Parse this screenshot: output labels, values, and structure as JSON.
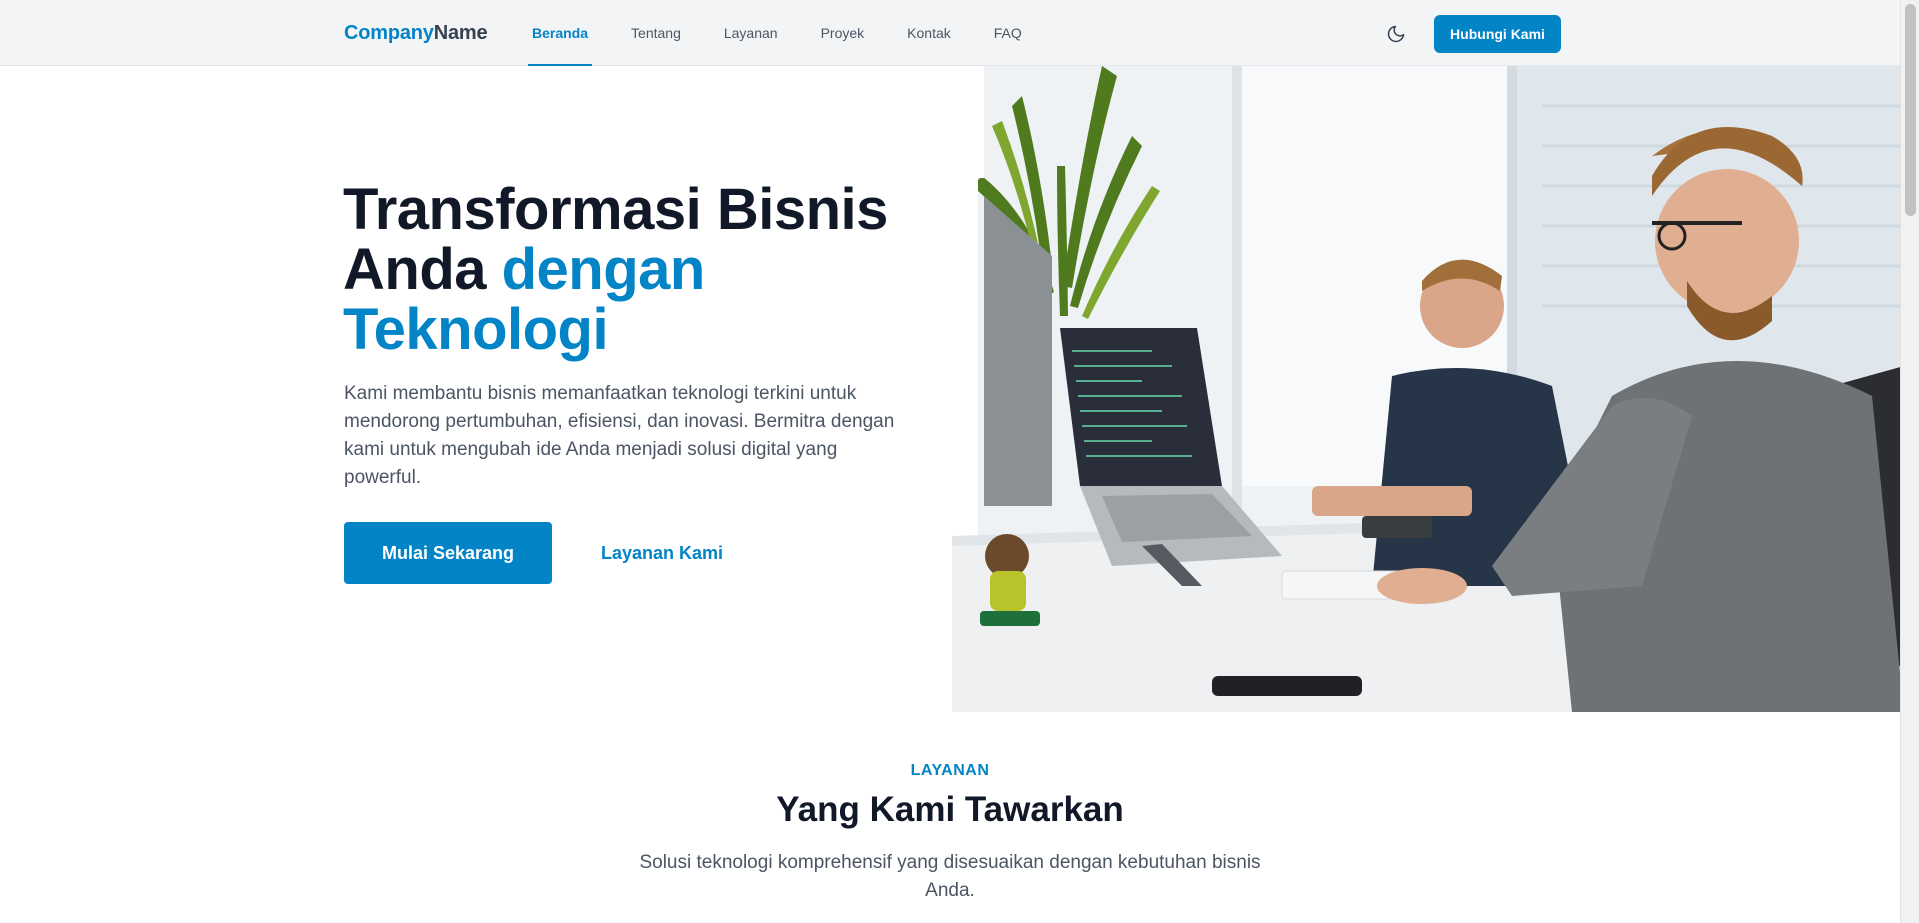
{
  "navbar": {
    "brand_part1": "Company",
    "brand_part2": "Name",
    "items": [
      {
        "label": "Beranda",
        "active": true
      },
      {
        "label": "Tentang",
        "active": false
      },
      {
        "label": "Layanan",
        "active": false
      },
      {
        "label": "Proyek",
        "active": false
      },
      {
        "label": "Kontak",
        "active": false
      },
      {
        "label": "FAQ",
        "active": false
      }
    ],
    "theme_icon": "moon-icon",
    "cta_label": "Hubungi Kami"
  },
  "hero": {
    "title_line1": "Transformasi Bisnis",
    "title_line2_plain": "Anda ",
    "title_line2_accent": "dengan",
    "title_line3_accent": "Teknologi",
    "description": "Kami membantu bisnis memanfaatkan teknologi terkini untuk mendorong pertumbuhan, efisiensi, dan inovasi. Bermitra dengan kami untuk mengubah ide Anda menjadi solusi digital yang powerful.",
    "primary_button": "Mulai Sekarang",
    "secondary_button": "Layanan Kami"
  },
  "services": {
    "eyebrow": "LAYANAN",
    "title": "Yang Kami Tawarkan",
    "description": "Solusi teknologi komprehensif yang disesuaikan dengan kebutuhan bisnis Anda."
  },
  "colors": {
    "accent": "#0284c7",
    "heading": "#111827",
    "body_text": "#4b5563",
    "navbar_bg": "#f3f4f6"
  }
}
